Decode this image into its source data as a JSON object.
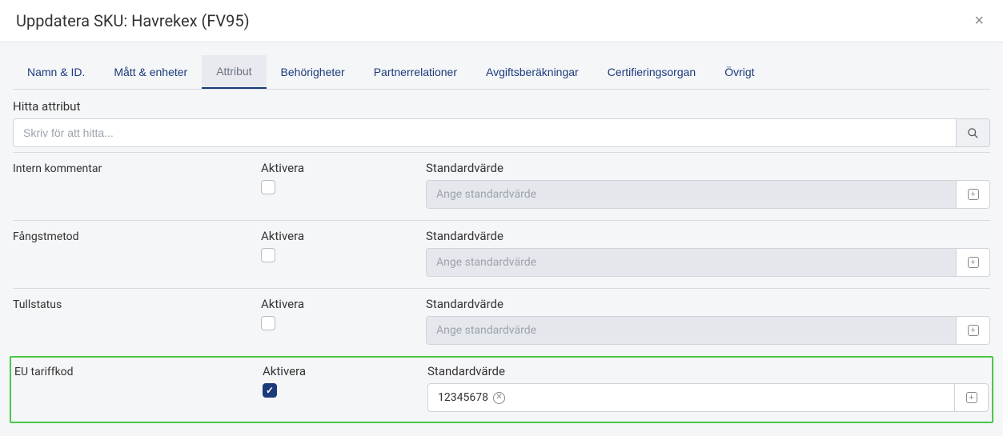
{
  "header": {
    "title": "Uppdatera SKU: Havrekex (FV95)"
  },
  "tabs": [
    {
      "label": "Namn & ID.",
      "active": false
    },
    {
      "label": "Mått & enheter",
      "active": false
    },
    {
      "label": "Attribut",
      "active": true
    },
    {
      "label": "Behörigheter",
      "active": false
    },
    {
      "label": "Partnerrelationer",
      "active": false
    },
    {
      "label": "Avgiftsberäkningar",
      "active": false
    },
    {
      "label": "Certifieringsorgan",
      "active": false
    },
    {
      "label": "Övrigt",
      "active": false
    }
  ],
  "search": {
    "label": "Hitta attribut",
    "placeholder": "Skriv för att hitta..."
  },
  "columns": {
    "activate": "Aktivera",
    "default": "Standardvärde"
  },
  "default_placeholder": "Ange standardvärde",
  "rows": [
    {
      "name": "Intern kommentar",
      "checked": false,
      "value": "",
      "highlighted": false
    },
    {
      "name": "Fångstmetod",
      "checked": false,
      "value": "",
      "highlighted": false
    },
    {
      "name": "Tullstatus",
      "checked": false,
      "value": "",
      "highlighted": false
    },
    {
      "name": "EU tariffkod",
      "checked": true,
      "value": "12345678",
      "highlighted": true
    }
  ]
}
